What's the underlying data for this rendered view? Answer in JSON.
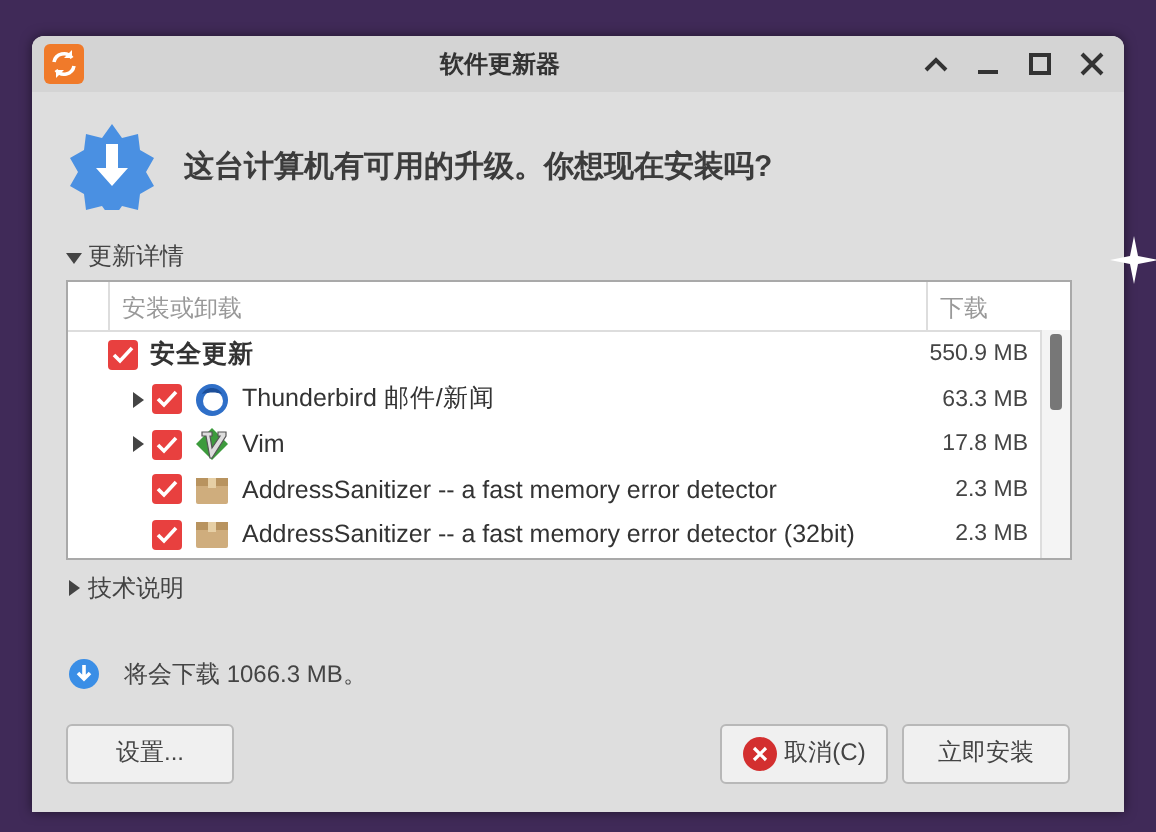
{
  "window": {
    "title": "软件更新器"
  },
  "header": {
    "message": "这台计算机有可用的升级。你想现在安装吗?"
  },
  "details": {
    "label": "更新详情",
    "expanded": true,
    "table": {
      "columns": [
        "安装或卸载",
        "下载"
      ],
      "rows": [
        {
          "kind": "group",
          "label": "安全更新",
          "size": "550.9 MB",
          "checked": true,
          "children": [
            {
              "kind": "mail",
              "label": "Thunderbird 邮件/新闻",
              "size": "63.3 MB",
              "checked": true,
              "expanded": false
            },
            {
              "kind": "editor",
              "label": "Vim",
              "size": "17.8 MB",
              "checked": true,
              "expanded": false
            },
            {
              "kind": "package",
              "label": "AddressSanitizer -- a fast memory error detector",
              "size": "2.3 MB",
              "checked": true
            },
            {
              "kind": "package",
              "label": "AddressSanitizer -- a fast memory error detector (32bit)",
              "size": "2.3 MB",
              "checked": true
            }
          ]
        }
      ]
    }
  },
  "technical": {
    "label": "技术说明",
    "expanded": false
  },
  "status": {
    "text": "将会下载 1066.3 MB。"
  },
  "left_buttons": [
    {
      "label": "设置..."
    }
  ],
  "right_buttons": [
    {
      "label": "取消(C)",
      "kind": "cancel"
    },
    {
      "label": "立即安装",
      "kind": "plain"
    }
  ]
}
